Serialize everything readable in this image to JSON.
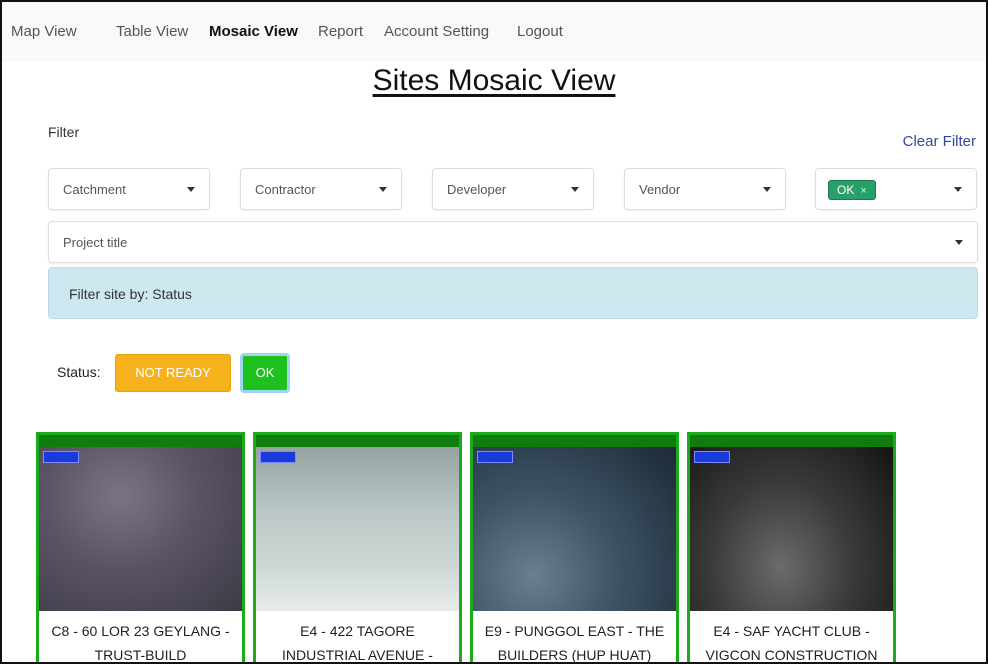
{
  "nav": {
    "items": [
      {
        "label": "Map View",
        "active": false
      },
      {
        "label": "Table View",
        "active": false
      },
      {
        "label": "Mosaic View",
        "active": true
      },
      {
        "label": "Report",
        "active": false
      },
      {
        "label": "Account Setting",
        "active": false
      },
      {
        "label": "Logout",
        "active": false
      }
    ]
  },
  "page": {
    "title": "Sites Mosaic View"
  },
  "filter": {
    "label": "Filter",
    "clear_label": "Clear Filter",
    "selects": {
      "catchment": "Catchment",
      "contractor": "Contractor",
      "developer": "Developer",
      "vendor": "Vendor",
      "project_title": "Project title"
    },
    "status_chip": "OK",
    "chip_remove": "×",
    "info_text": "Filter site by: Status"
  },
  "status": {
    "label": "Status:",
    "not_ready": "NOT READY",
    "ok": "OK",
    "colors": {
      "not_ready": "#f5b21c",
      "ok": "#1fc11f"
    }
  },
  "sites": [
    {
      "label": "C8 - 60 LOR 23 GEYLANG - TRUST-BUILD"
    },
    {
      "label": "E4 - 422 TAGORE INDUSTRIAL AVENUE -"
    },
    {
      "label": "E9 - PUNGGOL EAST - THE BUILDERS (HUP HUAT)"
    },
    {
      "label": "E4 - SAF YACHT CLUB - VIGCON CONSTRUCTION"
    }
  ]
}
